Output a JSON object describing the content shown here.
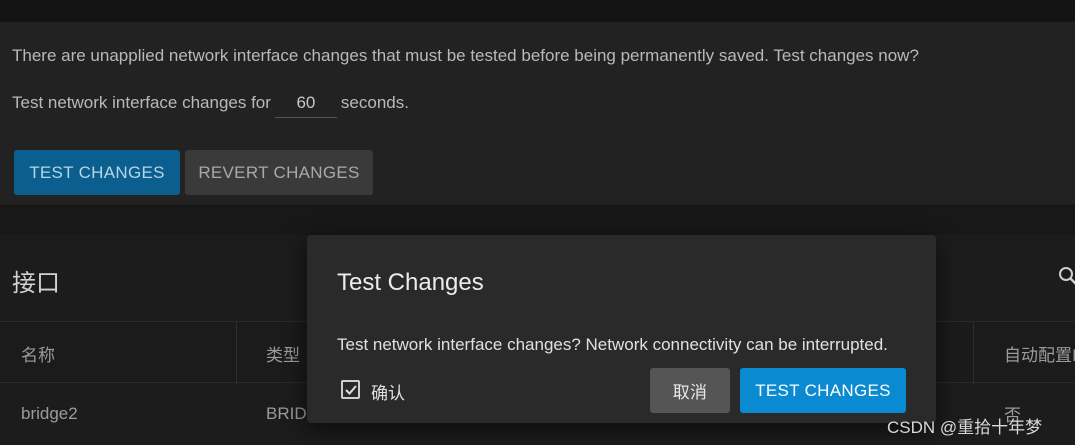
{
  "banner": {
    "message": "There are unapplied network interface changes that must be tested before being permanently saved. Test changes now?",
    "duration_prefix": "Test network interface changes for",
    "duration_value": "60",
    "duration_suffix": "seconds.",
    "test_button": "TEST CHANGES",
    "revert_button": "REVERT CHANGES"
  },
  "panel": {
    "title": "接口",
    "columns": [
      "名称",
      "类型",
      "自动配置I"
    ],
    "rows": [
      {
        "name": "bridge2",
        "type": "BRID",
        "auto": "否"
      }
    ]
  },
  "dialog": {
    "title": "Test Changes",
    "message": "Test network interface changes? Network connectivity can be interrupted.",
    "confirm_label": "确认",
    "confirm_checked": true,
    "cancel_button": "取消",
    "test_button": "TEST CHANGES"
  },
  "watermark": "CSDN @重拾十年梦",
  "icons": {
    "search": "search-icon",
    "check": "checkmark-icon"
  },
  "colors": {
    "primary": "#0a8ad0",
    "primary_dim": "#0a5f8f"
  }
}
